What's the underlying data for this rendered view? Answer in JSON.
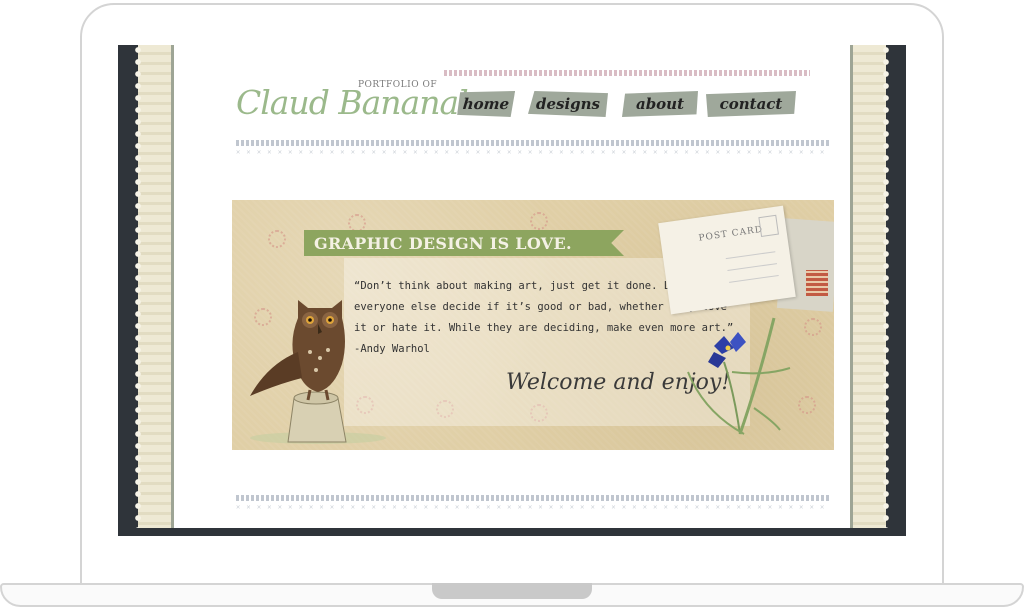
{
  "site": {
    "logo_prefix": "PORTFOLIO OF",
    "logo_name": "Claud Bananal"
  },
  "nav": {
    "items": [
      {
        "label": "home"
      },
      {
        "label": "designs"
      },
      {
        "label": "about"
      },
      {
        "label": "contact"
      }
    ]
  },
  "banner": {
    "heading": "GRAPHIC DESIGN IS LOVE.",
    "quote": "“Don’t think about making art, just get it done. Let everyone else decide if it’s good or bad, whether they love it or hate it. While they are deciding, make even more art.” -Andy Warhol",
    "welcome": "Welcome and enjoy!",
    "postcard_text": "POST CARD"
  },
  "colors": {
    "logo_green": "#9bb98b",
    "nav_tab": "#9fa89b",
    "ribbon_green": "#8da55f",
    "banner_bg": "#e0cfa6",
    "screen_frame": "#2f343a"
  },
  "icons": {
    "owl": "owl-illustration",
    "iris": "iris-flower-illustration",
    "postcard": "vintage-postcard-illustration"
  }
}
